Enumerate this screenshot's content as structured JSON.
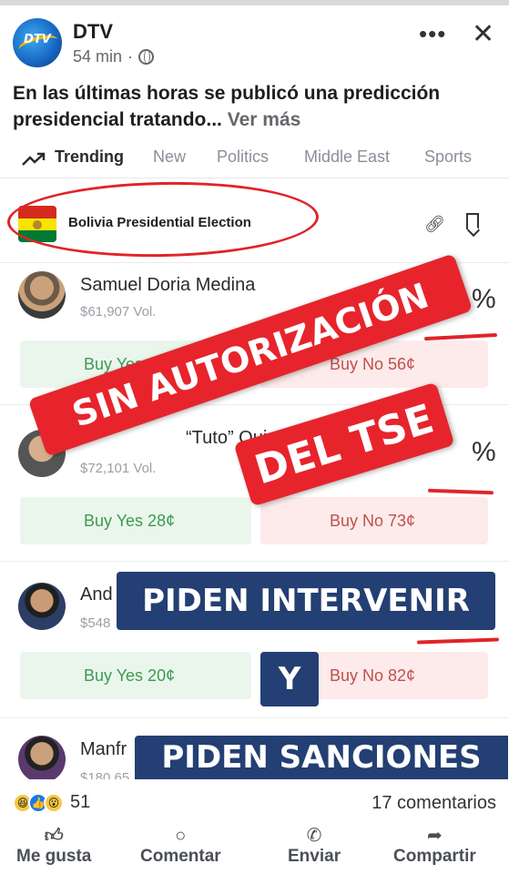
{
  "post": {
    "page_name": "DTV",
    "avatar_text": "DTV",
    "time": "54 min",
    "separator": "·",
    "caption": "En las últimas horas se publicó una predicción presidencial tratando...",
    "see_more": "Ver más"
  },
  "market": {
    "tabs": [
      "Trending",
      "New",
      "Politics",
      "Middle East",
      "Sports"
    ],
    "election_title": "Bolivia Presidential Election",
    "candidates": [
      {
        "name": "Samuel Doria Medina",
        "volume": "$61,907 Vol.",
        "pct_fragment": "%",
        "buy_yes": "Buy Yes 4",
        "buy_no": "Buy No 56¢"
      },
      {
        "name": "“Tuto” Quiroga",
        "volume": "$72,101 Vol.",
        "pct_fragment": "%",
        "buy_yes": "Buy Yes 28¢",
        "buy_no": "Buy No 73¢"
      },
      {
        "name": "And",
        "volume": "$548",
        "pct_fragment": "",
        "buy_yes": "Buy Yes 20¢",
        "buy_no": "Buy No 82¢"
      },
      {
        "name": "Manfr",
        "volume": "$180,65",
        "pct_fragment": "",
        "buy_yes": "",
        "buy_no": ""
      }
    ]
  },
  "overlays": {
    "sin_autorizacion": "SIN AUTORIZACIÓN",
    "del_tse": "DEL TSE",
    "piden_intervenir": "PIDEN INTERVENIR",
    "y": "Y",
    "piden_sanciones": "PIDEN SANCIONES"
  },
  "footer": {
    "reaction_count": "51",
    "comments": "17 comentarios",
    "actions": [
      "Me gusta",
      "Comentar",
      "Enviar",
      "Compartir"
    ]
  },
  "colors": {
    "overlay_red": "#e7242c",
    "overlay_navy": "#233f73",
    "yes_green": "#3c9a52",
    "no_red": "#c0504d"
  }
}
